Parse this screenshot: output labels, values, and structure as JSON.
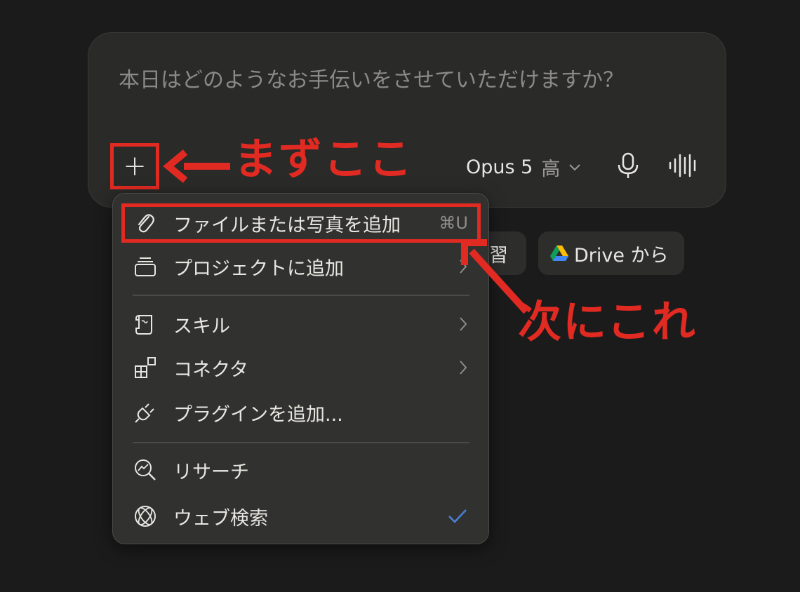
{
  "composer": {
    "placeholder": "本日はどのようなお手伝いをさせていただけますか？",
    "plus_label": "+",
    "model_name": "Opus 5",
    "effort": "高"
  },
  "annotations": {
    "first": "まずここ",
    "next": "次にこれ",
    "color": "#e02a22"
  },
  "chips": {
    "learn_fragment": "習",
    "drive_label": "Drive から"
  },
  "menu": {
    "items": [
      {
        "label": "ファイルまたは写真を追加",
        "shortcut": "⌘U",
        "icon": "paperclip-icon"
      },
      {
        "label": "プロジェクトに追加",
        "icon": "folder-stack-icon"
      },
      {
        "label": "スキル",
        "icon": "scroll-icon"
      },
      {
        "label": "コネクタ",
        "icon": "blocks-icon"
      },
      {
        "label": "プラグインを追加...",
        "icon": "plug-icon"
      },
      {
        "label": "リサーチ",
        "icon": "research-icon"
      },
      {
        "label": "ウェブ検索",
        "icon": "globe-icon",
        "checked": true
      }
    ]
  },
  "colors": {
    "background": "#1b1b1b",
    "surface": "#2a2a29",
    "menu": "#31312f",
    "check": "#4a7fd4"
  }
}
